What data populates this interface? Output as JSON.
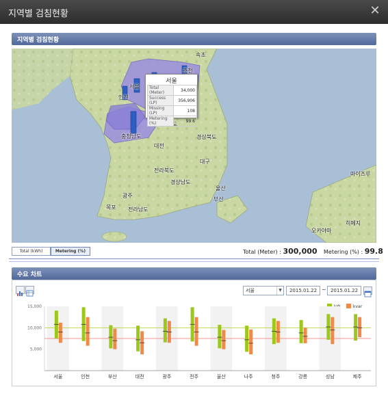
{
  "window": {
    "title": "지역별 검침현황",
    "close_icon": "close-icon"
  },
  "map_section": {
    "title": "지역별 검침현황"
  },
  "map": {
    "labels": [
      {
        "name": "map-label-sokcho",
        "text": "속초"
      },
      {
        "name": "map-label-chuncheon",
        "text": "춘천"
      },
      {
        "name": "map-label-seoul",
        "text": "서울"
      },
      {
        "name": "map-label-incheon",
        "text": "인천"
      },
      {
        "name": "map-label-chungbuk",
        "text": "충청북도"
      },
      {
        "name": "map-label-chungnam",
        "text": "충청남도"
      },
      {
        "name": "map-label-daejeon",
        "text": "대전"
      },
      {
        "name": "map-label-gyeongbuk",
        "text": "경상북도"
      },
      {
        "name": "map-label-daegu",
        "text": "대구"
      },
      {
        "name": "map-label-jeonbuk",
        "text": "전라북도"
      },
      {
        "name": "map-label-gyeongnam",
        "text": "경상남도"
      },
      {
        "name": "map-label-ulsan",
        "text": "울산"
      },
      {
        "name": "map-label-gwangju",
        "text": "광주"
      },
      {
        "name": "map-label-busan",
        "text": "부산"
      },
      {
        "name": "map-label-mokpo",
        "text": "목포"
      },
      {
        "name": "map-label-jeonnam",
        "text": "전라남도"
      },
      {
        "name": "map-label-maizuru",
        "text": "마이즈루"
      },
      {
        "name": "map-label-himeji",
        "text": "히메지"
      },
      {
        "name": "map-label-okayama",
        "text": "오카야마"
      }
    ],
    "tooltip": {
      "title": "서울",
      "rows": [
        {
          "key": "Total (Meter)",
          "value": "34,000"
        },
        {
          "key": "Success (LP)",
          "value": "356,906"
        },
        {
          "key": "Missing (LP)",
          "value": "108"
        },
        {
          "key": "Metering (%)",
          "value": "99.6"
        }
      ]
    }
  },
  "tabs": [
    {
      "label": "Total (kWh)",
      "active": false
    },
    {
      "label": "Metering (%)",
      "active": true
    }
  ],
  "totals": {
    "total_label": "Total (Meter) :",
    "total_value": "300,000",
    "metering_label": "Metering (%) :",
    "metering_value": "99.8"
  },
  "chart_section": {
    "title": "수요 차트"
  },
  "chart_controls": {
    "region_selected": "서울",
    "date_from": "2015.01.22",
    "date_to": "2015.01.22",
    "tilde": "~",
    "icons": [
      "bar-chart-icon",
      "table-view-icon",
      "calendar-icon"
    ]
  },
  "colors": {
    "kw": "#9bc81a",
    "kvar": "#f08a4b",
    "accent": "#51689a",
    "region_highlight": "#9b8fe0"
  },
  "chart_data": {
    "type": "box",
    "categories": [
      "서울",
      "인천",
      "부산",
      "대전",
      "광주",
      "전주",
      "울산",
      "나주",
      "청주",
      "강릉",
      "성남",
      "제주"
    ],
    "ylim": [
      0,
      15000
    ],
    "yticks": [
      "5,000",
      "10,000",
      "15,000"
    ],
    "ytick_values": [
      5000,
      10000,
      15000
    ],
    "reference_lines": [
      {
        "value": 10000,
        "color": "#b5d33a"
      },
      {
        "value": 7500,
        "color": "#f07070"
      }
    ],
    "series": [
      {
        "name": "kW",
        "values": [
          {
            "low": 7500,
            "high": 14000,
            "mid": 10800
          },
          {
            "low": 6900,
            "high": 14800,
            "mid": 10800
          },
          {
            "low": 5200,
            "high": 10600,
            "mid": 7800
          },
          {
            "low": 4500,
            "high": 10500,
            "mid": 7200
          },
          {
            "low": 6600,
            "high": 12200,
            "mid": 9200
          },
          {
            "low": 6800,
            "high": 14800,
            "mid": 10800
          },
          {
            "low": 5200,
            "high": 10700,
            "mid": 7800
          },
          {
            "low": 4400,
            "high": 10500,
            "mid": 7200
          },
          {
            "low": 6200,
            "high": 12200,
            "mid": 9200
          },
          {
            "low": 6400,
            "high": 11800,
            "mid": 8800
          },
          {
            "low": 7200,
            "high": 13200,
            "mid": 10200
          },
          {
            "low": 7000,
            "high": 13200,
            "mid": 10200
          }
        ]
      },
      {
        "name": "kvar",
        "values": [
          {
            "low": 6500,
            "high": 11200,
            "mid": 9000
          },
          {
            "low": 5800,
            "high": 12500,
            "mid": 8800
          },
          {
            "low": 5000,
            "high": 9800,
            "mid": 7000
          },
          {
            "low": 3800,
            "high": 9200,
            "mid": 6500
          },
          {
            "low": 6500,
            "high": 11600,
            "mid": 9000
          },
          {
            "low": 5800,
            "high": 12500,
            "mid": 9000
          },
          {
            "low": 5000,
            "high": 9500,
            "mid": 7000
          },
          {
            "low": 3800,
            "high": 9600,
            "mid": 6400
          },
          {
            "low": 6500,
            "high": 11600,
            "mid": 9000
          },
          {
            "low": 6400,
            "high": 10000,
            "mid": 8000
          },
          {
            "low": 6200,
            "high": 12500,
            "mid": 9500
          },
          {
            "low": 7800,
            "high": 12500,
            "mid": 10000
          }
        ]
      }
    ],
    "legend": [
      "kW",
      "kvar"
    ],
    "legend_position": "top-right",
    "grid": false
  }
}
